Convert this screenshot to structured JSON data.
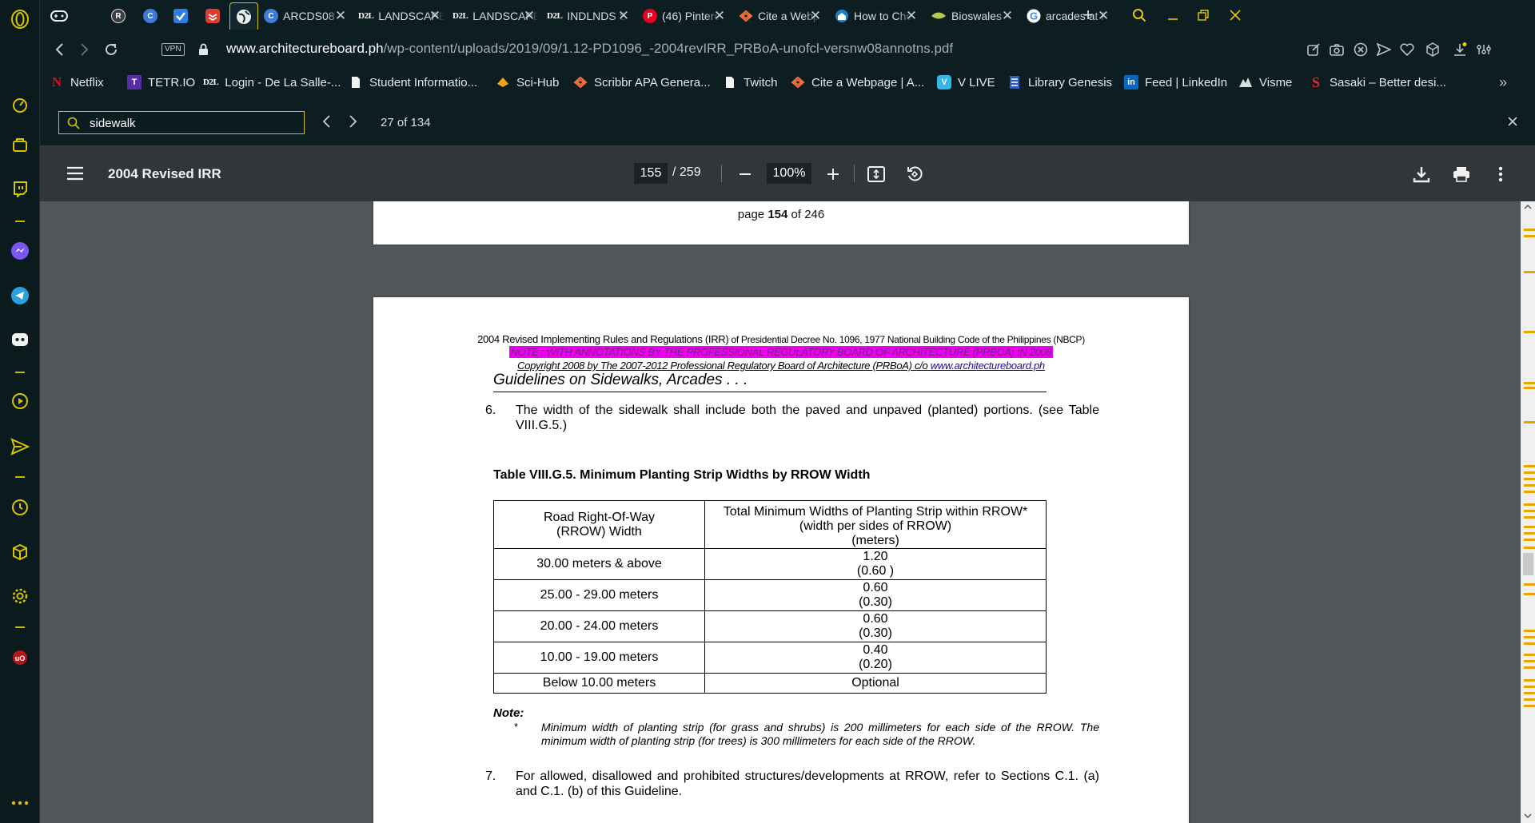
{
  "tabs": [
    {
      "title": "ARCDS08 -",
      "favicon": "c-icon"
    },
    {
      "title": "LANDSCAPE",
      "favicon": "d2l-icon"
    },
    {
      "title": "LANDSCAPE",
      "favicon": "d2l-icon"
    },
    {
      "title": "INDLNDS S",
      "favicon": "d2l-icon"
    },
    {
      "title": "(46) Pintere",
      "favicon": "pinterest-icon"
    },
    {
      "title": "Cite a Webp",
      "favicon": "scribbr-icon"
    },
    {
      "title": "How to Cho",
      "favicon": "home-icon"
    },
    {
      "title": "Bioswales –",
      "favicon": "leaf-icon"
    },
    {
      "title": "arcades at R",
      "favicon": "google-icon"
    }
  ],
  "address": {
    "vpn_label": "VPN",
    "url_host": "www.architectureboard.ph",
    "url_path": "/wp-content/uploads/2019/09/1.12-PD1096_-2004revIRR_PRBoA-unofcl-versnw08annotns.pdf"
  },
  "bookmarks": [
    {
      "label": "Netflix",
      "icon": "netflix-icon"
    },
    {
      "label": "TETR.IO",
      "icon": "tetrio-icon"
    },
    {
      "label": "Login - De La Salle-...",
      "icon": "d2l-icon"
    },
    {
      "label": "Student Informatio...",
      "icon": "document-icon"
    },
    {
      "label": "Sci-Hub",
      "icon": "scihub-icon"
    },
    {
      "label": "Scribbr APA Genera...",
      "icon": "scribbr-icon"
    },
    {
      "label": "Twitch",
      "icon": "document-icon"
    },
    {
      "label": "Cite a Webpage | A...",
      "icon": "scribbr-icon"
    },
    {
      "label": "V LIVE",
      "icon": "vlive-icon"
    },
    {
      "label": "Library Genesis",
      "icon": "library-icon"
    },
    {
      "label": "Feed | LinkedIn",
      "icon": "linkedin-icon"
    },
    {
      "label": "Visme",
      "icon": "visme-icon"
    },
    {
      "label": "Sasaki – Better desi...",
      "icon": "sasaki-icon"
    }
  ],
  "find": {
    "query": "sidewalk",
    "count": "27 of 134"
  },
  "pdf_toolbar": {
    "title": "2004 Revised IRR",
    "page": "155",
    "total": "/ 259",
    "zoom": "100%"
  },
  "prev_page": {
    "footer_pre": "page ",
    "footer_num": "154",
    "footer_post": " of 246"
  },
  "doc": {
    "header_line1_a": "2004 Revised Implementing Rules and Regulations (IRR)",
    "header_line1_b": " of Presidential Decree No. 1096, 1977 National Building Code of the Philippines (NBCP)",
    "header_note": "NOTE : WITH ANNOTATIONS BY THE PROFESSIONAL REGULATORY BOARD OF ARCHITECTURE (PRBOA) IN 2008",
    "header_copyright": "Copyright 2008 by The 2007-2012 Professional Regulatory Board of Architecture (PRBoA) c/o  ",
    "header_link": "www.architectureboard.ph",
    "running_head": "Guidelines on Sidewalks, Arcades . . .",
    "item6_num": "6.",
    "item6_text": "The width of the sidewalk shall include both the paved and unpaved (planted) portions. (see Table VIII.G.5.)",
    "table_caption": "Table  VIII.G.5.   Minimum Planting Strip Widths by RROW Width",
    "table": {
      "col1_header_l1": "Road Right-Of-Way",
      "col1_header_l2": "(RROW) Width",
      "col2_header_l1": "Total Minimum Widths of Planting Strip within  RROW*",
      "col2_header_l2": "(width per sides of RROW)",
      "col2_header_l3": "(meters)",
      "rows": [
        {
          "rrow": "30.00 meters & above",
          "total": "1.20",
          "per_side": "(0.60 )"
        },
        {
          "rrow": "25.00 - 29.00 meters",
          "total": "0.60",
          "per_side": "(0.30)"
        },
        {
          "rrow": "20.00 - 24.00 meters",
          "total": "0.60",
          "per_side": "(0.30)"
        },
        {
          "rrow": "10.00 - 19.00 meters",
          "total": "0.40",
          "per_side": "(0.20)"
        },
        {
          "rrow": "Below 10.00 meters",
          "total": "Optional"
        }
      ]
    },
    "note_label": "Note:",
    "note_star": "*",
    "note_text": "Minimum width of planting strip (for grass and shrubs) is 200 millimeters for each side of the RROW.  The minimum width of planting strip (for trees) is 300 millimeters for each side of the RROW.",
    "item7_num": "7.",
    "item7_text": "For allowed, disallowed and prohibited structures/developments at RROW, refer to Sections C.1. (a) and C.1. (b) of this Guideline."
  },
  "colors": {
    "accent": "#d9c200",
    "highlight": "#f000f0",
    "toolbar": "#323639",
    "viewer_bg": "#525659"
  }
}
